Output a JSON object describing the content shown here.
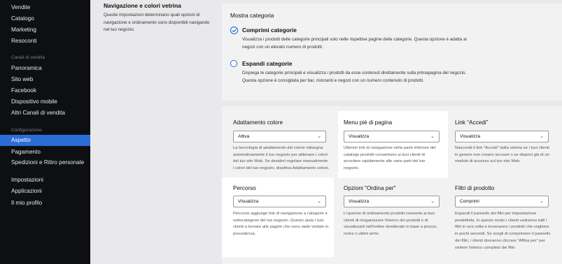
{
  "sidebar": {
    "items_top": [
      {
        "label": "Vendite"
      },
      {
        "label": "Catalogo"
      },
      {
        "label": "Marketing"
      },
      {
        "label": "Resoconti"
      }
    ],
    "section_channels": "Canali di vendita",
    "items_channels": [
      {
        "label": "Panoramica"
      },
      {
        "label": "Sito web"
      },
      {
        "label": "Facebook"
      },
      {
        "label": "Dispositivo mobile"
      },
      {
        "label": "Altri Canali di vendita"
      }
    ],
    "section_config": "Configurazione",
    "items_config": [
      {
        "label": "Aspetto",
        "active": true
      },
      {
        "label": "Pagamento"
      },
      {
        "label": "Spedizioni e Ritiro personale"
      },
      {
        "label": "Impostazioni"
      },
      {
        "label": "Applicazioni"
      },
      {
        "label": "Il mio profilo"
      }
    ]
  },
  "nav_section": {
    "title": "Navigazione e colori vetrina",
    "description": "Queste impostazioni determinano quali opzioni di navigazione e ordinamento sono disponibili navigando nel tuo negozio."
  },
  "category": {
    "title": "Mostra categoria",
    "options": [
      {
        "label": "Comprimi categorie",
        "description": "Visualizza i prodotti delle categorie principali solo nelle rispettive pagine delle categorie. Questa opzione è adatta ai negozi con un elevato numero di prodotti.",
        "selected": true
      },
      {
        "label": "Espandi categorie",
        "description": "Dispiega le categorie principali e visualizza i prodotti da esse contenuti direttamente sulla primapagina del negozio. Questa opzione è consigliata per bar, ristoranti e negozi con un numero contenuto di prodotti.",
        "selected": false
      }
    ]
  },
  "settings": {
    "adattamento": {
      "title": "Adattamento colore",
      "value": "Attiva",
      "description": "La tecnologia di adattamento del colore ridisegna automaticamente il tuo negozio per abbinare i colori del tuo sito Web. Se desideri regolare manualmente i colori del tuo negozio, disattiva Adattamento colore."
    },
    "menu_pie": {
      "title": "Menu piè di pagina",
      "value": "Visualizza",
      "description": "Ulteriori link di navigazione nella parte inferiore del catalogo prodotti consentono ai tuoi clienti di accedere rapidamente alle varie parti del tuo negozio."
    },
    "link_accedi": {
      "title": "Link “Accedi”",
      "value": "Visualizza",
      "description": "Nascondi il link \"Accedi\" dalla vetrina se i tuoi clienti in genere non creano account o se disponi già di un modulo di accesso sul tuo sito Web."
    },
    "percorso": {
      "title": "Percorso",
      "value": "Visualizza",
      "description": "Percorso aggiunge link di navigazione a categorie e sottocategorie del tuo negozio. Questo aiuta i tuoi clienti a tornare alle pagine che sono state visitate in precedenza."
    },
    "ordina_per": {
      "title": "Opzioni \"Ordina per\"",
      "value": "Visualizza",
      "description": "L'opzione di ordinamento prodotti consente ai tuoi clienti di riorganizzare l'elenco dei prodotti e di visualizzarli nell'ordine desiderato in base a prezzo, nome o ultimi arrivi."
    },
    "filtri": {
      "title": "Filtri di prodotto",
      "value": "Comprimi",
      "description": "Espandi il pannello dei filtri per impostazione predefinita. In questo modo i clienti vedranno tutti i filtri in una volta e troveranno i prodotti che vogliono in pochi secondi. Se scegli di comprimere il pannello dei filtri, i clienti dovranno cliccare \"Affina per\" per vedere l'elenco completo dei filtri."
    }
  },
  "colors": {
    "accent": "#2c6cd6",
    "sidebar_bg": "#0d0f12",
    "page_bg": "#e9e9eb"
  }
}
